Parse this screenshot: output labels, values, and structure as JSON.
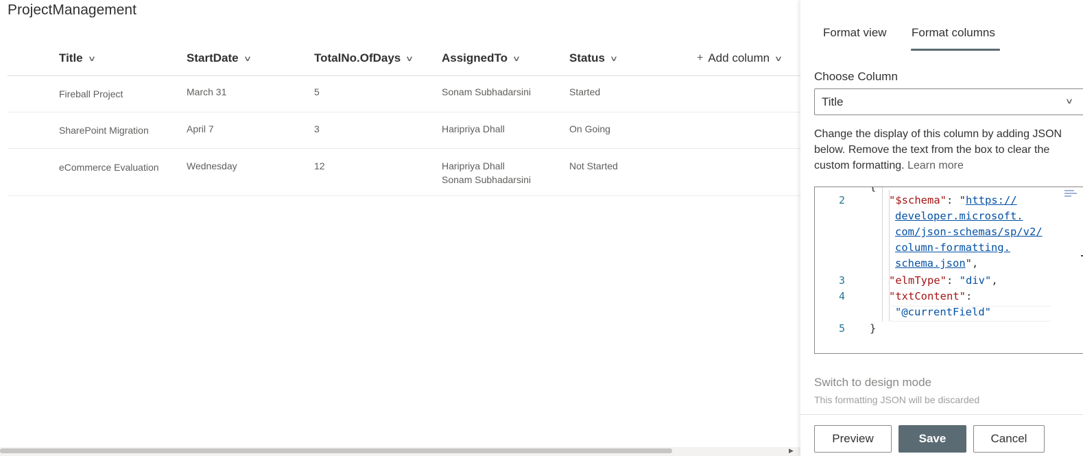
{
  "list": {
    "title": "ProjectManagement",
    "columns": [
      {
        "label": "Title"
      },
      {
        "label": "StartDate"
      },
      {
        "label": "TotalNo.OfDays"
      },
      {
        "label": "AssignedTo"
      },
      {
        "label": "Status"
      }
    ],
    "add_column": {
      "icon": "plus-icon",
      "label": "Add column"
    },
    "rows": [
      {
        "title": "Fireball Project",
        "start_date": "March 31",
        "total_days": "5",
        "assigned_to": [
          "Sonam Subhadarsini"
        ],
        "status": "Started"
      },
      {
        "title": "SharePoint Migration",
        "start_date": "April 7",
        "total_days": "3",
        "assigned_to": [
          "Haripriya Dhall"
        ],
        "status": "On Going"
      },
      {
        "title": "eCommerce Evaluation",
        "start_date": "Wednesday",
        "total_days": "12",
        "assigned_to": [
          "Haripriya Dhall",
          "Sonam Subhadarsini"
        ],
        "status": "Not Started"
      }
    ]
  },
  "panel": {
    "tabs": [
      {
        "label": "Format view",
        "active": false
      },
      {
        "label": "Format columns",
        "active": true
      }
    ],
    "choose_column_label": "Choose Column",
    "selected_column": "Title",
    "description": "Change the display of this column by adding JSON below. Remove the text from the box to clear the custom formatting.",
    "learn_more": "Learn more",
    "editor": {
      "line_numbers": [
        "2",
        "3",
        "4",
        "5"
      ],
      "schema_key": "\"$schema\"",
      "schema_url_lines": [
        "https://",
        "developer.microsoft.",
        "com/json-schemas/sp/v2/",
        "column-formatting.",
        "schema.json"
      ],
      "elm_key": "\"elmType\"",
      "elm_value": "\"div\"",
      "txt_key": "\"txtContent\"",
      "txt_value": "\"@currentField\"",
      "closing_brace": "}"
    },
    "switch_link": "Switch to design mode",
    "discard_note": "This formatting JSON will be discarded",
    "buttons": {
      "preview": "Preview",
      "save": "Save",
      "cancel": "Cancel"
    }
  },
  "colors": {
    "accent": "#5b6b73",
    "json_key": "#a31515",
    "json_string": "#0451a5",
    "line_number": "#237893"
  }
}
